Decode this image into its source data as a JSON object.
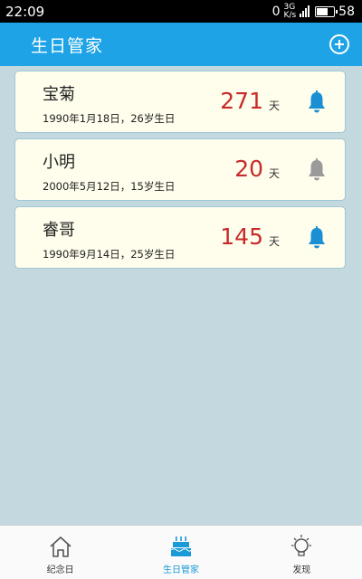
{
  "status": {
    "time": "22:09",
    "data_rate": "0",
    "data_rate_unit": "K/s",
    "network": "3G",
    "battery": "58"
  },
  "app_bar": {
    "title": "生日管家"
  },
  "birthdays": [
    {
      "name": "宝菊",
      "detail": "1990年1月18日，26岁生日",
      "days": "271",
      "unit": "天",
      "reminder": true
    },
    {
      "name": "小明",
      "detail": "2000年5月12日，15岁生日",
      "days": "20",
      "unit": "天",
      "reminder": false
    },
    {
      "name": "睿哥",
      "detail": "1990年9月14日，25岁生日",
      "days": "145",
      "unit": "天",
      "reminder": true
    }
  ],
  "nav": [
    {
      "label": "纪念日",
      "icon": "home-icon",
      "active": false
    },
    {
      "label": "生日管家",
      "icon": "birthday-cake-icon",
      "active": true
    },
    {
      "label": "发现",
      "icon": "lightbulb-icon",
      "active": false
    }
  ],
  "colors": {
    "accent": "#1ea3e6",
    "days": "#c62a2a",
    "bell_on": "#1a8fd4",
    "bell_off": "#9a9a9a"
  }
}
